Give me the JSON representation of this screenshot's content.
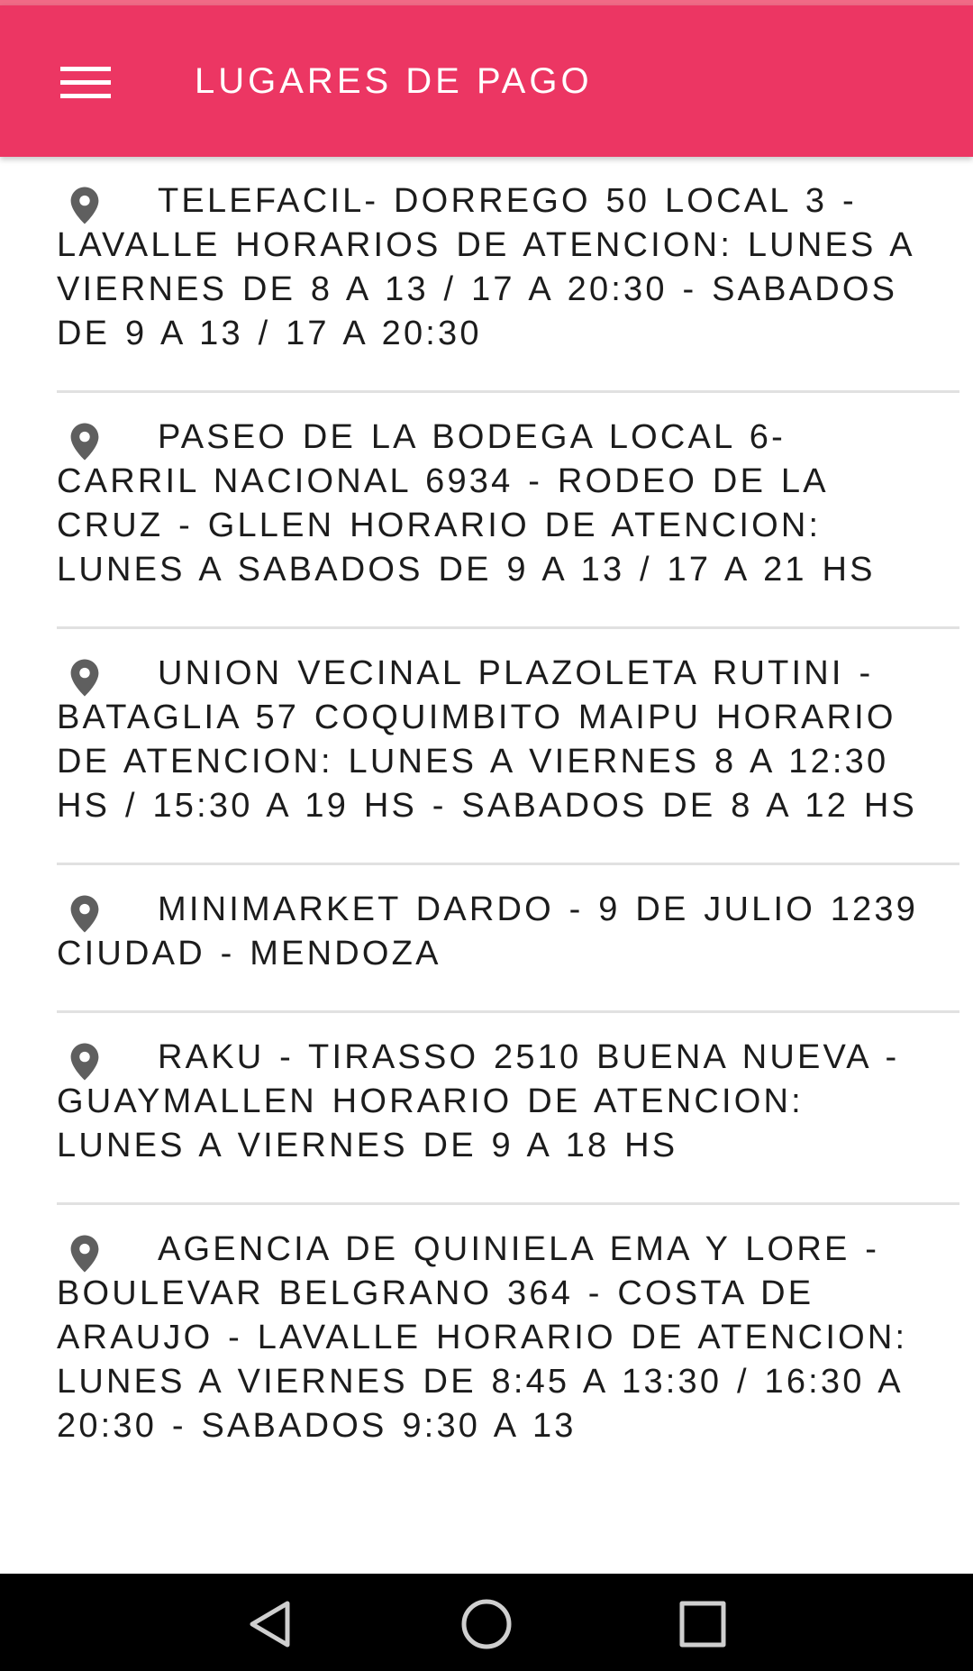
{
  "colors": {
    "app_bar": "#ec3663",
    "status_strip": "#f06a86",
    "divider": "#e1e1e1",
    "text": "#1c1c1c",
    "icon": "#5f5f5f",
    "nav_bar": "#000000"
  },
  "app_bar": {
    "menu_icon": "hamburger-menu-icon",
    "title": "LUGARES DE PAGO"
  },
  "list": {
    "item_icon": "location-pin-icon",
    "items": [
      {
        "text": "TELEFACIL- DORREGO 50 LOCAL 3 - LAVALLE HORARIOS DE ATENCION: LUNES A VIERNES DE 8 A 13 / 17 A 20:30 - SABADOS DE 9 A 13 / 17 A 20:30"
      },
      {
        "text": "PASEO DE LA BODEGA LOCAL 6- CARRIL NACIONAL 6934 - RODEO DE LA CRUZ - GLLEN HORARIO DE ATENCION: LUNES A SABADOS DE 9 A 13 / 17 A 21 HS"
      },
      {
        "text": "UNION VECINAL PLAZOLETA RUTINI - BATAGLIA 57 COQUIMBITO MAIPU HORARIO DE ATENCION: LUNES A VIERNES 8 A 12:30 HS / 15:30 A 19 HS - SABADOS DE 8 A 12 HS"
      },
      {
        "text": "MINIMARKET DARDO - 9 DE JULIO 1239 CIUDAD - MENDOZA"
      },
      {
        "text": "RAKU - TIRASSO 2510 BUENA NUEVA - GUAYMALLEN HORARIO DE ATENCION: LUNES A VIERNES DE 9 A 18 HS"
      },
      {
        "text": "AGENCIA DE QUINIELA EMA Y LORE - BOULEVAR BELGRANO 364 - COSTA DE ARAUJO - LAVALLE HORARIO DE ATENCION: LUNES A VIERNES DE 8:45 A 13:30 / 16:30 A 20:30 - SABADOS 9:30 A 13"
      }
    ]
  },
  "nav_bar": {
    "back_icon": "back-triangle-icon",
    "home_icon": "home-circle-icon",
    "recents_icon": "recents-square-icon"
  }
}
